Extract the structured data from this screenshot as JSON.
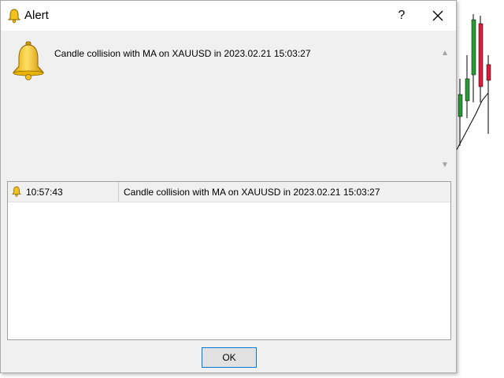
{
  "window": {
    "title": "Alert",
    "help_label": "?",
    "close_icon": "close-icon",
    "title_icon": "bell-icon"
  },
  "message": {
    "text": "Candle collision with MA on XAUUSD in 2023.02.21 15:03:27",
    "icon": "bell-icon"
  },
  "list": {
    "rows": [
      {
        "time": "10:57:43",
        "message": "Candle collision with MA on XAUUSD in 2023.02.21 15:03:27"
      }
    ]
  },
  "buttons": {
    "ok_label": "OK"
  },
  "colors": {
    "bell": "#f2c21b",
    "ok_border": "#0078d7",
    "candle_up": "#1e8a2a",
    "candle_down": "#d81e3c"
  }
}
